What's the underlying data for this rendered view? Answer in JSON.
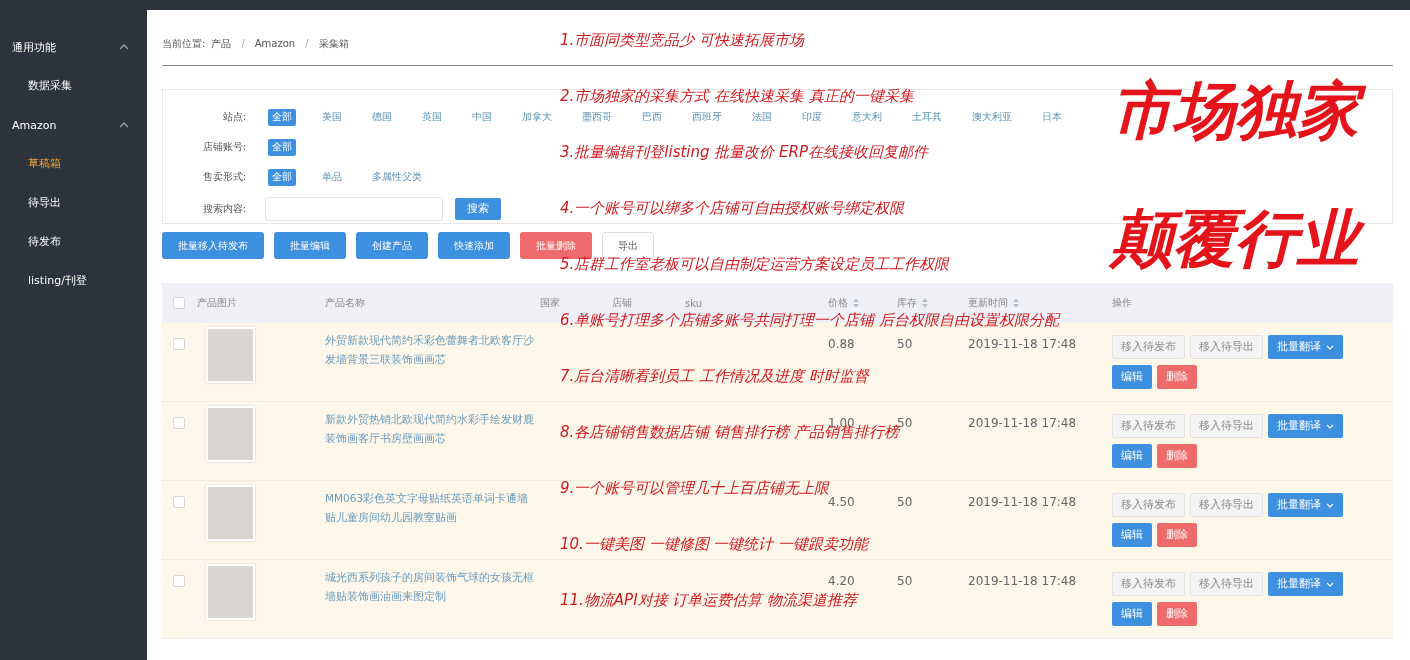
{
  "sidebar": {
    "groups": [
      {
        "label": "通用功能",
        "expanded": true,
        "items": [
          {
            "label": "数据采集",
            "selected": false
          }
        ]
      },
      {
        "label": "Amazon",
        "expanded": true,
        "items": [
          {
            "label": "草稿箱",
            "selected": true
          },
          {
            "label": "待导出",
            "selected": false
          },
          {
            "label": "待发布",
            "selected": false
          },
          {
            "label": "listing/刊登",
            "selected": false
          }
        ]
      }
    ]
  },
  "breadcrumb": {
    "label": "当前位置:",
    "separator": "/",
    "items": [
      "产品",
      "Amazon",
      "采集箱"
    ]
  },
  "filters": [
    {
      "label": "站点:",
      "options": [
        {
          "label": "全部",
          "selected": true
        },
        {
          "label": "美国",
          "selected": false
        },
        {
          "label": "德国",
          "selected": false
        },
        {
          "label": "英国",
          "selected": false
        },
        {
          "label": "中国",
          "selected": false
        },
        {
          "label": "加拿大",
          "selected": false
        },
        {
          "label": "墨西哥",
          "selected": false
        },
        {
          "label": "巴西",
          "selected": false
        },
        {
          "label": "西班牙",
          "selected": false
        },
        {
          "label": "法国",
          "selected": false
        },
        {
          "label": "印度",
          "selected": false
        },
        {
          "label": "意大利",
          "selected": false
        },
        {
          "label": "土耳其",
          "selected": false
        },
        {
          "label": "澳大利亚",
          "selected": false
        },
        {
          "label": "日本",
          "selected": false
        }
      ]
    },
    {
      "label": "店铺账号:",
      "options": [
        {
          "label": "全部",
          "selected": true
        }
      ]
    },
    {
      "label": "售卖形式:",
      "options": [
        {
          "label": "全部",
          "selected": true
        },
        {
          "label": "单品",
          "selected": false
        },
        {
          "label": "多属性父类",
          "selected": false
        }
      ]
    }
  ],
  "search": {
    "label": "搜索内容:",
    "button": "搜索"
  },
  "actions": [
    {
      "label": "批量移入待发布",
      "kind": "primary"
    },
    {
      "label": "批量编辑",
      "kind": "primary"
    },
    {
      "label": "创建产品",
      "kind": "primary"
    },
    {
      "label": "快速添加",
      "kind": "primary"
    },
    {
      "label": "批量删除",
      "kind": "danger"
    },
    {
      "label": "导出",
      "kind": "plain"
    }
  ],
  "table": {
    "all_checked": false,
    "columns": [
      {
        "label": "产品图片",
        "sortable": false
      },
      {
        "label": "产品名称",
        "sortable": false
      },
      {
        "label": "国家",
        "sortable": false
      },
      {
        "label": "店铺",
        "sortable": false
      },
      {
        "label": "sku",
        "sortable": false
      },
      {
        "label": "价格",
        "sortable": true
      },
      {
        "label": "库存",
        "sortable": true
      },
      {
        "label": "更新时间",
        "sortable": true
      },
      {
        "label": "操作",
        "sortable": false
      }
    ],
    "rows": [
      {
        "checked": false,
        "name": "外贸新款现代简约禾彩色蕾舞者北欧客厅沙发墙背景三联装饰画画芯",
        "price": "0.88",
        "stock": "50",
        "updated": "2019-11-18 17:48",
        "actions": [
          {
            "label": "移入待发布",
            "kind": "plain"
          },
          {
            "label": "移入待导出",
            "kind": "plain"
          },
          {
            "label": "批量翻译",
            "kind": "dropdown"
          },
          {
            "label": "编辑",
            "kind": "primary"
          },
          {
            "label": "删除",
            "kind": "danger"
          }
        ]
      },
      {
        "checked": false,
        "name": "新款外贸热销北欧现代简约水彩手绘发财鹿装饰画客厅书房壁画画芯",
        "price": "1.00",
        "stock": "50",
        "updated": "2019-11-18 17:48",
        "actions": [
          {
            "label": "移入待发布",
            "kind": "plain"
          },
          {
            "label": "移入待导出",
            "kind": "plain"
          },
          {
            "label": "批量翻译",
            "kind": "dropdown"
          },
          {
            "label": "编辑",
            "kind": "primary"
          },
          {
            "label": "删除",
            "kind": "danger"
          }
        ]
      },
      {
        "checked": false,
        "name": "MM063彩色英文字母贴纸英语单词卡通墙贴儿童房间幼儿园教室贴画",
        "price": "4.50",
        "stock": "50",
        "updated": "2019-11-18 17:48",
        "actions": [
          {
            "label": "移入待发布",
            "kind": "plain"
          },
          {
            "label": "移入待导出",
            "kind": "plain"
          },
          {
            "label": "批量翻译",
            "kind": "dropdown"
          },
          {
            "label": "编辑",
            "kind": "primary"
          },
          {
            "label": "删除",
            "kind": "danger"
          }
        ]
      },
      {
        "checked": false,
        "name": "城光西系列孩子的房间装饰气球的女孩无框墙贴装饰画油画来图定制",
        "price": "4.20",
        "stock": "50",
        "updated": "2019-11-18 17:48",
        "actions": [
          {
            "label": "移入待发布",
            "kind": "plain"
          },
          {
            "label": "移入待导出",
            "kind": "plain"
          },
          {
            "label": "批量翻译",
            "kind": "dropdown"
          },
          {
            "label": "编辑",
            "kind": "primary"
          },
          {
            "label": "删除",
            "kind": "danger"
          }
        ]
      }
    ]
  },
  "annotations": [
    "1.市面同类型竞品少 可快速拓展市场",
    "2.市场独家的采集方式 在线快速采集 真正的一键采集",
    "3.批量编辑刊登listing  批量改价 ERP在线接收回复邮件",
    "4.一个账号可以绑多个店铺可自由授权账号绑定权限",
    "5.店群工作室老板可以自由制定运营方案设定员工工作权限",
    "6.单账号打理多个店铺多账号共同打理一个店铺 后台权限自由设置权限分配",
    "7.后台清晰看到员工 工作情况及进度 时时监督",
    "8.各店铺销售数据店铺 销售排行榜 产品销售排行榜",
    "9.一个账号可以管理几十上百店铺无上限",
    "10.一键美图 一键修图 一键统计 一键跟卖功能",
    "11.物流API对接 订单运费估算 物流渠道推荐"
  ],
  "slogans": [
    "市场独家",
    "颠覆行业"
  ]
}
